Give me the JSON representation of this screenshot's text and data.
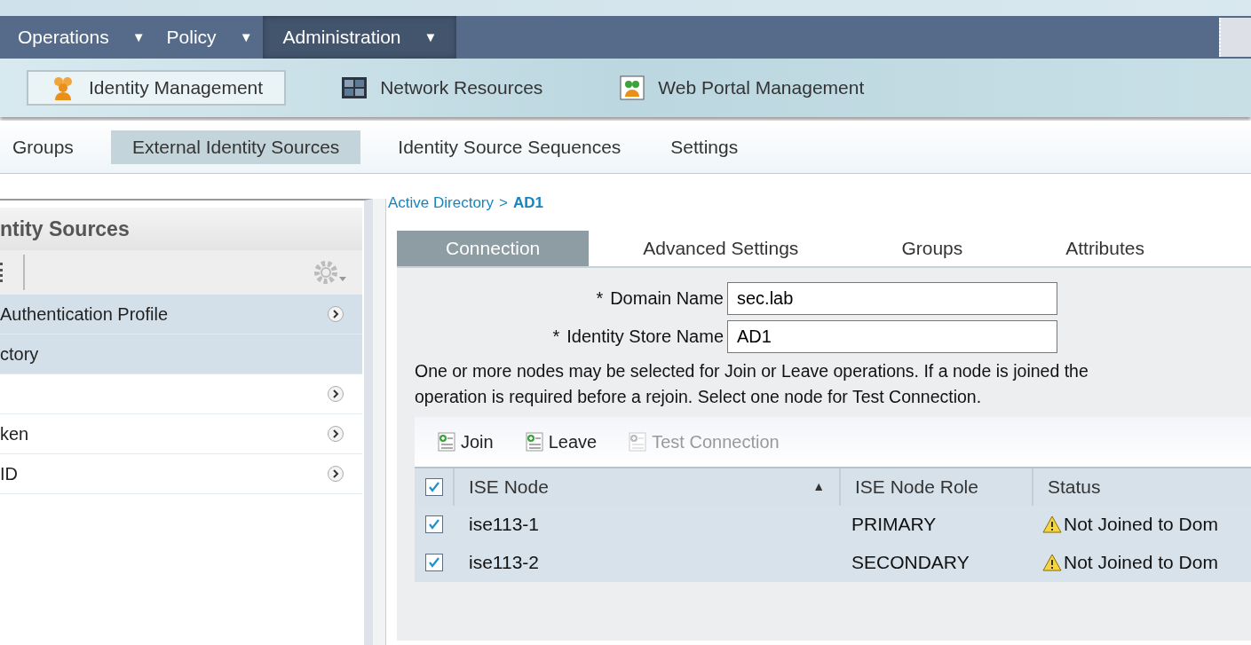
{
  "top_nav": [
    {
      "label": "Operations",
      "caret": "▼",
      "selected": false
    },
    {
      "label": "Policy",
      "caret": "▼",
      "selected": false
    },
    {
      "label": "Administration",
      "caret": "▼",
      "selected": true
    }
  ],
  "sub_nav": [
    {
      "label": "Identity Management",
      "selected": true,
      "kind": "people"
    },
    {
      "label": "Network Resources",
      "selected": false,
      "kind": "grid"
    },
    {
      "label": "Web Portal Management",
      "selected": false,
      "kind": "portal"
    }
  ],
  "section_tabs": [
    {
      "label": "Groups",
      "selected": false
    },
    {
      "label": "External Identity Sources",
      "selected": true
    },
    {
      "label": "Identity Source Sequences",
      "selected": false
    },
    {
      "label": "Settings",
      "selected": false
    }
  ],
  "sidebar": {
    "title": "ntity Sources",
    "items": [
      {
        "label": "Authentication Profile",
        "selected": true,
        "arrow": true
      },
      {
        "label": "ctory",
        "selected": true,
        "arrow": false
      },
      {
        "selected": false,
        "arrow": true
      },
      {
        "label": "ken",
        "selected": false,
        "arrow": true
      },
      {
        "label": "ID",
        "selected": false,
        "arrow": true
      }
    ]
  },
  "breadcrumb": {
    "parent": "Active Directory",
    "separator": ">",
    "current": "AD1"
  },
  "tabs": [
    {
      "label": "Connection",
      "selected": true
    },
    {
      "label": "Advanced Settings",
      "selected": false
    },
    {
      "label": "Groups",
      "selected": false
    },
    {
      "label": "Attributes",
      "selected": false
    }
  ],
  "form": [
    {
      "mark": "*",
      "label": "Domain Name",
      "value": "sec.lab"
    },
    {
      "mark": "*",
      "label": "Identity Store Name",
      "value": "AD1"
    }
  ],
  "info_text": [
    "One or more nodes may be selected for Join or Leave operations. If a node is joined the",
    "operation is required before a rejoin. Select one node for Test Connection."
  ],
  "toolbar": [
    {
      "label": "Join",
      "disabled": false
    },
    {
      "label": "Leave",
      "disabled": false
    },
    {
      "label": "Test Connection",
      "disabled": true
    }
  ],
  "table": {
    "select_all": true,
    "columns": [
      {
        "label": "ISE Node",
        "sort_mark": "▲"
      },
      {
        "label": "ISE Node Role"
      },
      {
        "label": "Status"
      }
    ],
    "rows": [
      {
        "checked": true,
        "node": "ise113-1",
        "role": "PRIMARY",
        "status": "Not Joined to Dom"
      },
      {
        "checked": true,
        "node": "ise113-2",
        "role": "SECONDARY",
        "status": "Not Joined to Dom"
      }
    ]
  }
}
